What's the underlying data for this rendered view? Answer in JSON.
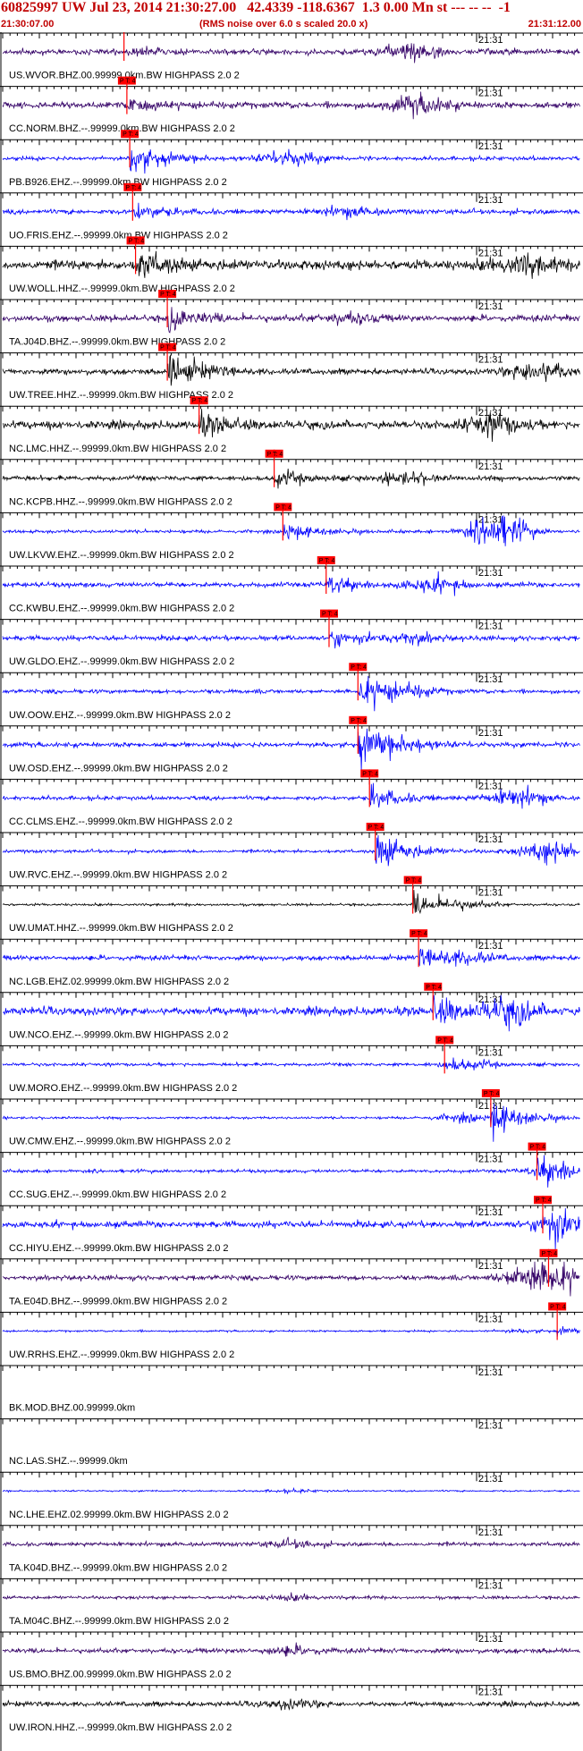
{
  "header": {
    "title": "60825997 UW Jul 23, 2014 21:30:27.00   42.4339 -118.6367  1.3 0.00 Mn st --- -- --  -1",
    "start_time": "21:30:07.00",
    "rms_note": "(RMS noise over 6.0 s scaled 20.0 x)",
    "end_time": "21:31:12.00"
  },
  "colors": {
    "red": "#ff0000",
    "blue": "#0000ff",
    "black": "#000000",
    "purple": "#330066",
    "navy": "#1a1a7a"
  },
  "minute_mark": "21:31",
  "pick_label": "P T: 4",
  "traces": [
    {
      "label": "US.WVOR.BHZ.00.99999.0km.BW  HIGHPASS  2.0  2",
      "color": "purple",
      "pick": 0.21,
      "amp": 0.35,
      "burst": 0.3,
      "late": 0.7,
      "lateAmp": 0.6
    },
    {
      "label": "CC.NORM.BHZ.--.99999.0km.BW  HIGHPASS  2.0  2",
      "color": "purple",
      "pick": 0.215,
      "amp": 0.4,
      "burst": 0.35,
      "late": 0.72,
      "lateAmp": 0.7
    },
    {
      "label": "PB.B926.EHZ.--.99999.0km.BW  HIGHPASS  2.0  2",
      "color": "blue",
      "pick": 0.22,
      "amp": 0.25,
      "burst": 1.0,
      "late": 0.5,
      "lateAmp": 0.6
    },
    {
      "label": "UO.FRIS.EHZ.--.99999.0km.BW  HIGHPASS  2.0  2",
      "color": "blue",
      "pick": 0.225,
      "amp": 0.3,
      "burst": 0.5,
      "late": 0.6,
      "lateAmp": 0.3
    },
    {
      "label": "UW.WOLL.HHZ.--.99999.0km.BW  HIGHPASS  2.0  2",
      "color": "black",
      "pick": 0.23,
      "amp": 0.6,
      "burst": 0.9,
      "late": 0.9,
      "lateAmp": 0.7
    },
    {
      "label": "TA.J04D.BHZ.--.99999.0km.BW  HIGHPASS  2.0  2",
      "color": "purple",
      "pick": 0.285,
      "amp": 0.4,
      "burst": 0.8,
      "late": 0.6,
      "lateAmp": 0.4
    },
    {
      "label": "UW.TREE.HHZ.--.99999.0km.BW  HIGHPASS  2.0  2",
      "color": "black",
      "pick": 0.285,
      "amp": 0.35,
      "burst": 1.3,
      "late": 0.93,
      "lateAmp": 0.9
    },
    {
      "label": "NC.LMC.HHZ.--.99999.0km.BW  HIGHPASS  2.0  2",
      "color": "black",
      "pick": 0.34,
      "amp": 0.5,
      "burst": 0.6,
      "late": 0.85,
      "lateAmp": 0.8
    },
    {
      "label": "NC.KCPB.HHZ.--.99999.0km.BW  HIGHPASS  2.0  2",
      "color": "black",
      "pick": 0.47,
      "amp": 0.3,
      "burst": 0.5,
      "late": 0.7,
      "lateAmp": 0.4
    },
    {
      "label": "UW.LKVW.EHZ.--.99999.0km.BW  HIGHPASS  2.0  2",
      "color": "blue",
      "pick": 0.485,
      "amp": 0.2,
      "burst": 0.6,
      "late": 0.86,
      "lateAmp": 1.4
    },
    {
      "label": "CC.KWBU.EHZ.--.99999.0km.BW  HIGHPASS  2.0  2",
      "color": "blue",
      "pick": 0.56,
      "amp": 0.3,
      "burst": 0.6,
      "late": 0.75,
      "lateAmp": 0.5
    },
    {
      "label": "UW.GLDO.EHZ.--.99999.0km.BW  HIGHPASS  2.0  2",
      "color": "blue",
      "pick": 0.565,
      "amp": 0.3,
      "burst": 0.5,
      "late": 0.7,
      "lateAmp": 0.4
    },
    {
      "label": "UW.OOW.EHZ.--.99999.0km.BW  HIGHPASS  2.0  2",
      "color": "blue",
      "pick": 0.615,
      "amp": 0.25,
      "burst": 1.2,
      "late": 0.7,
      "lateAmp": 0.3
    },
    {
      "label": "UW.OSD.EHZ.--.99999.0km.BW  HIGHPASS  2.0  2",
      "color": "blue",
      "pick": 0.615,
      "amp": 0.3,
      "burst": 1.2,
      "late": 0.7,
      "lateAmp": 0.3
    },
    {
      "label": "CC.CLMS.EHZ.--.99999.0km.BW  HIGHPASS  2.0  2",
      "color": "blue",
      "pick": 0.635,
      "amp": 0.25,
      "burst": 0.8,
      "late": 0.89,
      "lateAmp": 0.7
    },
    {
      "label": "UW.RVC.EHZ.--.99999.0km.BW  HIGHPASS  2.0  2",
      "color": "blue",
      "pick": 0.645,
      "amp": 0.2,
      "burst": 1.4,
      "late": 0.95,
      "lateAmp": 0.9
    },
    {
      "label": "UW.UMAT.HHZ.--.99999.0km.BW  HIGHPASS  2.0  2",
      "color": "black",
      "pick": 0.71,
      "amp": 0.15,
      "burst": 0.8,
      "late": 0.8,
      "lateAmp": 0.2
    },
    {
      "label": "NC.LGB.EHZ.02.99999.0km.BW  HIGHPASS  2.0  2",
      "color": "blue",
      "pick": 0.72,
      "amp": 0.3,
      "burst": 0.5,
      "late": 0.8,
      "lateAmp": 0.4
    },
    {
      "label": "UW.NCO.EHZ.--.99999.0km.BW  HIGHPASS  2.0  2",
      "color": "blue",
      "pick": 0.745,
      "amp": 0.5,
      "burst": 0.9,
      "late": 0.88,
      "lateAmp": 0.9
    },
    {
      "label": "UW.MORO.EHZ.--.99999.0km.BW  HIGHPASS  2.0  2",
      "color": "blue",
      "pick": 0.765,
      "amp": 0.2,
      "burst": 0.3,
      "late": 0.8,
      "lateAmp": 0.2
    },
    {
      "label": "UW.CMW.EHZ.--.99999.0km.BW  HIGHPASS  2.0  2",
      "color": "blue",
      "pick": 0.845,
      "amp": 0.15,
      "burst": 1.2,
      "late": 0.8,
      "lateAmp": 0.3
    },
    {
      "label": "CC.SUG.EHZ.--.99999.0km.BW  HIGHPASS  2.0  2",
      "color": "blue",
      "pick": 0.925,
      "amp": 0.2,
      "burst": 0.6,
      "late": 0.96,
      "lateAmp": 0.6
    },
    {
      "label": "CC.HIYU.EHZ.--.99999.0km.BW  HIGHPASS  2.0  2",
      "color": "blue",
      "pick": 0.935,
      "amp": 0.4,
      "burst": 0.8,
      "late": 0.97,
      "lateAmp": 0.8
    },
    {
      "label": "TA.E04D.BHZ.--.99999.0km.BW  HIGHPASS  2.0  2",
      "color": "purple",
      "pick": 0.945,
      "amp": 0.3,
      "burst": 1.0,
      "late": 0.92,
      "lateAmp": 1.3
    },
    {
      "label": "UW.RRHS.EHZ.--.99999.0km.BW  HIGHPASS  2.0  2",
      "color": "blue",
      "pick": 0.96,
      "amp": 0.12,
      "burst": 0.2,
      "late": 0.9,
      "lateAmp": 0.1
    },
    {
      "label": "BK.MOD.BHZ.00.99999.0km",
      "color": "none",
      "pick": null
    },
    {
      "label": "NC.LAS.SHZ.--.99999.0km",
      "color": "none",
      "pick": null
    },
    {
      "label": "NC.LHE.EHZ.02.99999.0km.BW  HIGHPASS  2.0  2",
      "color": "blue",
      "pick": null,
      "amp": 0.1,
      "burst": 0,
      "late": 0.5,
      "lateAmp": 0.1
    },
    {
      "label": "TA.K04D.BHZ.--.99999.0km.BW  HIGHPASS  2.0  2",
      "color": "purple",
      "pick": null,
      "amp": 0.25,
      "burst": 0,
      "late": 0.5,
      "lateAmp": 0.25
    },
    {
      "label": "TA.M04C.BHZ.--.99999.0km.BW  HIGHPASS  2.0  2",
      "color": "purple",
      "pick": null,
      "amp": 0.2,
      "burst": 0,
      "late": 0.5,
      "lateAmp": 0.2
    },
    {
      "label": "US.BMO.BHZ.00.99999.0km.BW  HIGHPASS  2.0  2",
      "color": "purple",
      "pick": null,
      "amp": 0.3,
      "burst": 0,
      "late": 0.5,
      "lateAmp": 0.3
    },
    {
      "label": "UW.IRON.HHZ.--.99999.0km.BW  HIGHPASS  2.0  2",
      "color": "black",
      "pick": null,
      "amp": 0.3,
      "burst": 0,
      "late": 0.5,
      "lateAmp": 0.3
    }
  ]
}
